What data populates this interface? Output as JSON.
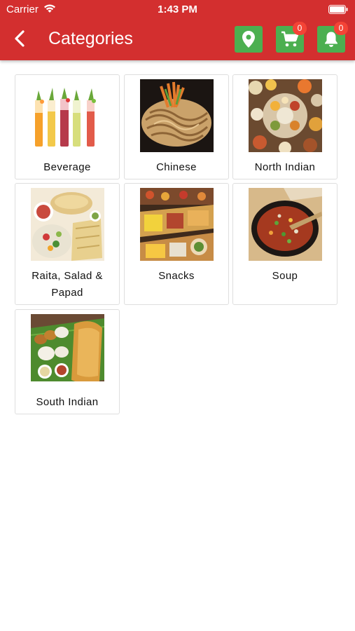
{
  "status_bar": {
    "carrier": "Carrier",
    "time": "1:43 PM"
  },
  "header": {
    "title": "Categories",
    "cart_count": "0",
    "notification_count": "0",
    "colors": {
      "bar": "#d32f2f",
      "action": "#4caf50",
      "badge": "#f44336"
    }
  },
  "categories": [
    {
      "label": "Beverage"
    },
    {
      "label": "Chinese"
    },
    {
      "label": "North Indian"
    },
    {
      "label": "Raita, Salad & Papad"
    },
    {
      "label": "Snacks"
    },
    {
      "label": "Soup"
    },
    {
      "label": "South Indian"
    }
  ]
}
